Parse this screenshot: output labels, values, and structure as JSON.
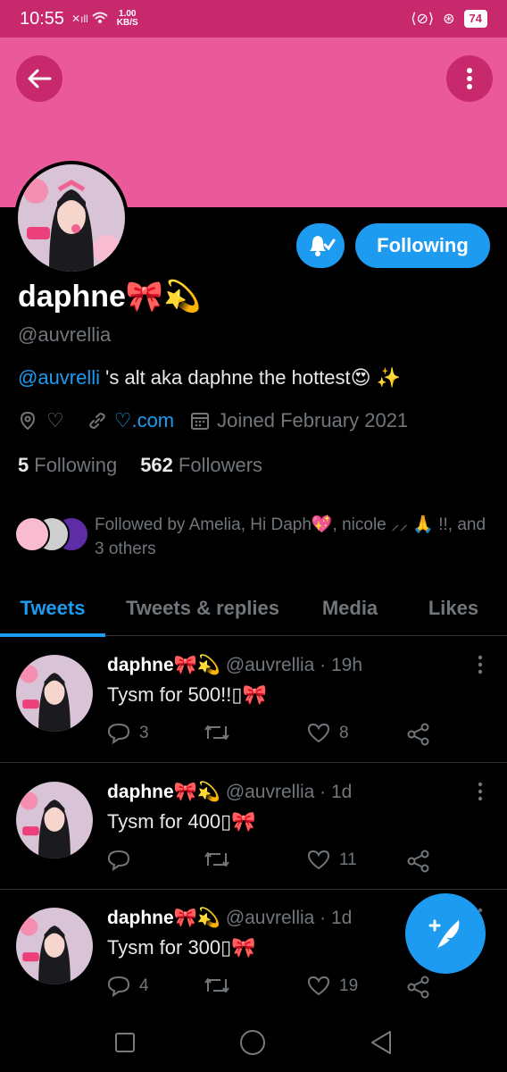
{
  "status_bar": {
    "time": "10:55",
    "net_speed": "1.00",
    "net_unit": "KB/S",
    "battery": "74"
  },
  "colors": {
    "accent": "#1d9bf0",
    "banner": "#ea5a9a",
    "status_bar": "#c8286c",
    "muted": "#71767b"
  },
  "profile": {
    "name": "daphne🎀💫",
    "handle": "@auvrellia",
    "bio_mention": "@auvrelli",
    "bio_text": " 's alt aka daphne the hottest😍 ✨",
    "location": "♡",
    "website": "♡.com",
    "joined": "Joined February 2021",
    "following_count": "5",
    "following_label": "Following",
    "followers_count": "562",
    "followers_label": "Followers",
    "followed_by": "Followed by Amelia, Hi Daph💖, nicole ⸝⸝ 🙏 !!, and 3 others"
  },
  "actions": {
    "follow_button": "Following"
  },
  "tabs": [
    {
      "label": "Tweets",
      "active": true
    },
    {
      "label": "Tweets & replies",
      "active": false
    },
    {
      "label": "Media",
      "active": false
    },
    {
      "label": "Likes",
      "active": false
    }
  ],
  "tweets": [
    {
      "name": "daphne🎀💫",
      "meta": "@auvrellia · 19h",
      "text": "Tysm for 500!!▯🎀",
      "replies": "3",
      "retweets": "",
      "likes": "8"
    },
    {
      "name": "daphne🎀💫",
      "meta": "@auvrellia · 1d",
      "text": "Tysm for 400▯🎀",
      "replies": "",
      "retweets": "",
      "likes": "11"
    },
    {
      "name": "daphne🎀💫",
      "meta": "@auvrellia · 1d",
      "text": "Tysm for 300▯🎀",
      "replies": "4",
      "retweets": "",
      "likes": "19"
    }
  ]
}
